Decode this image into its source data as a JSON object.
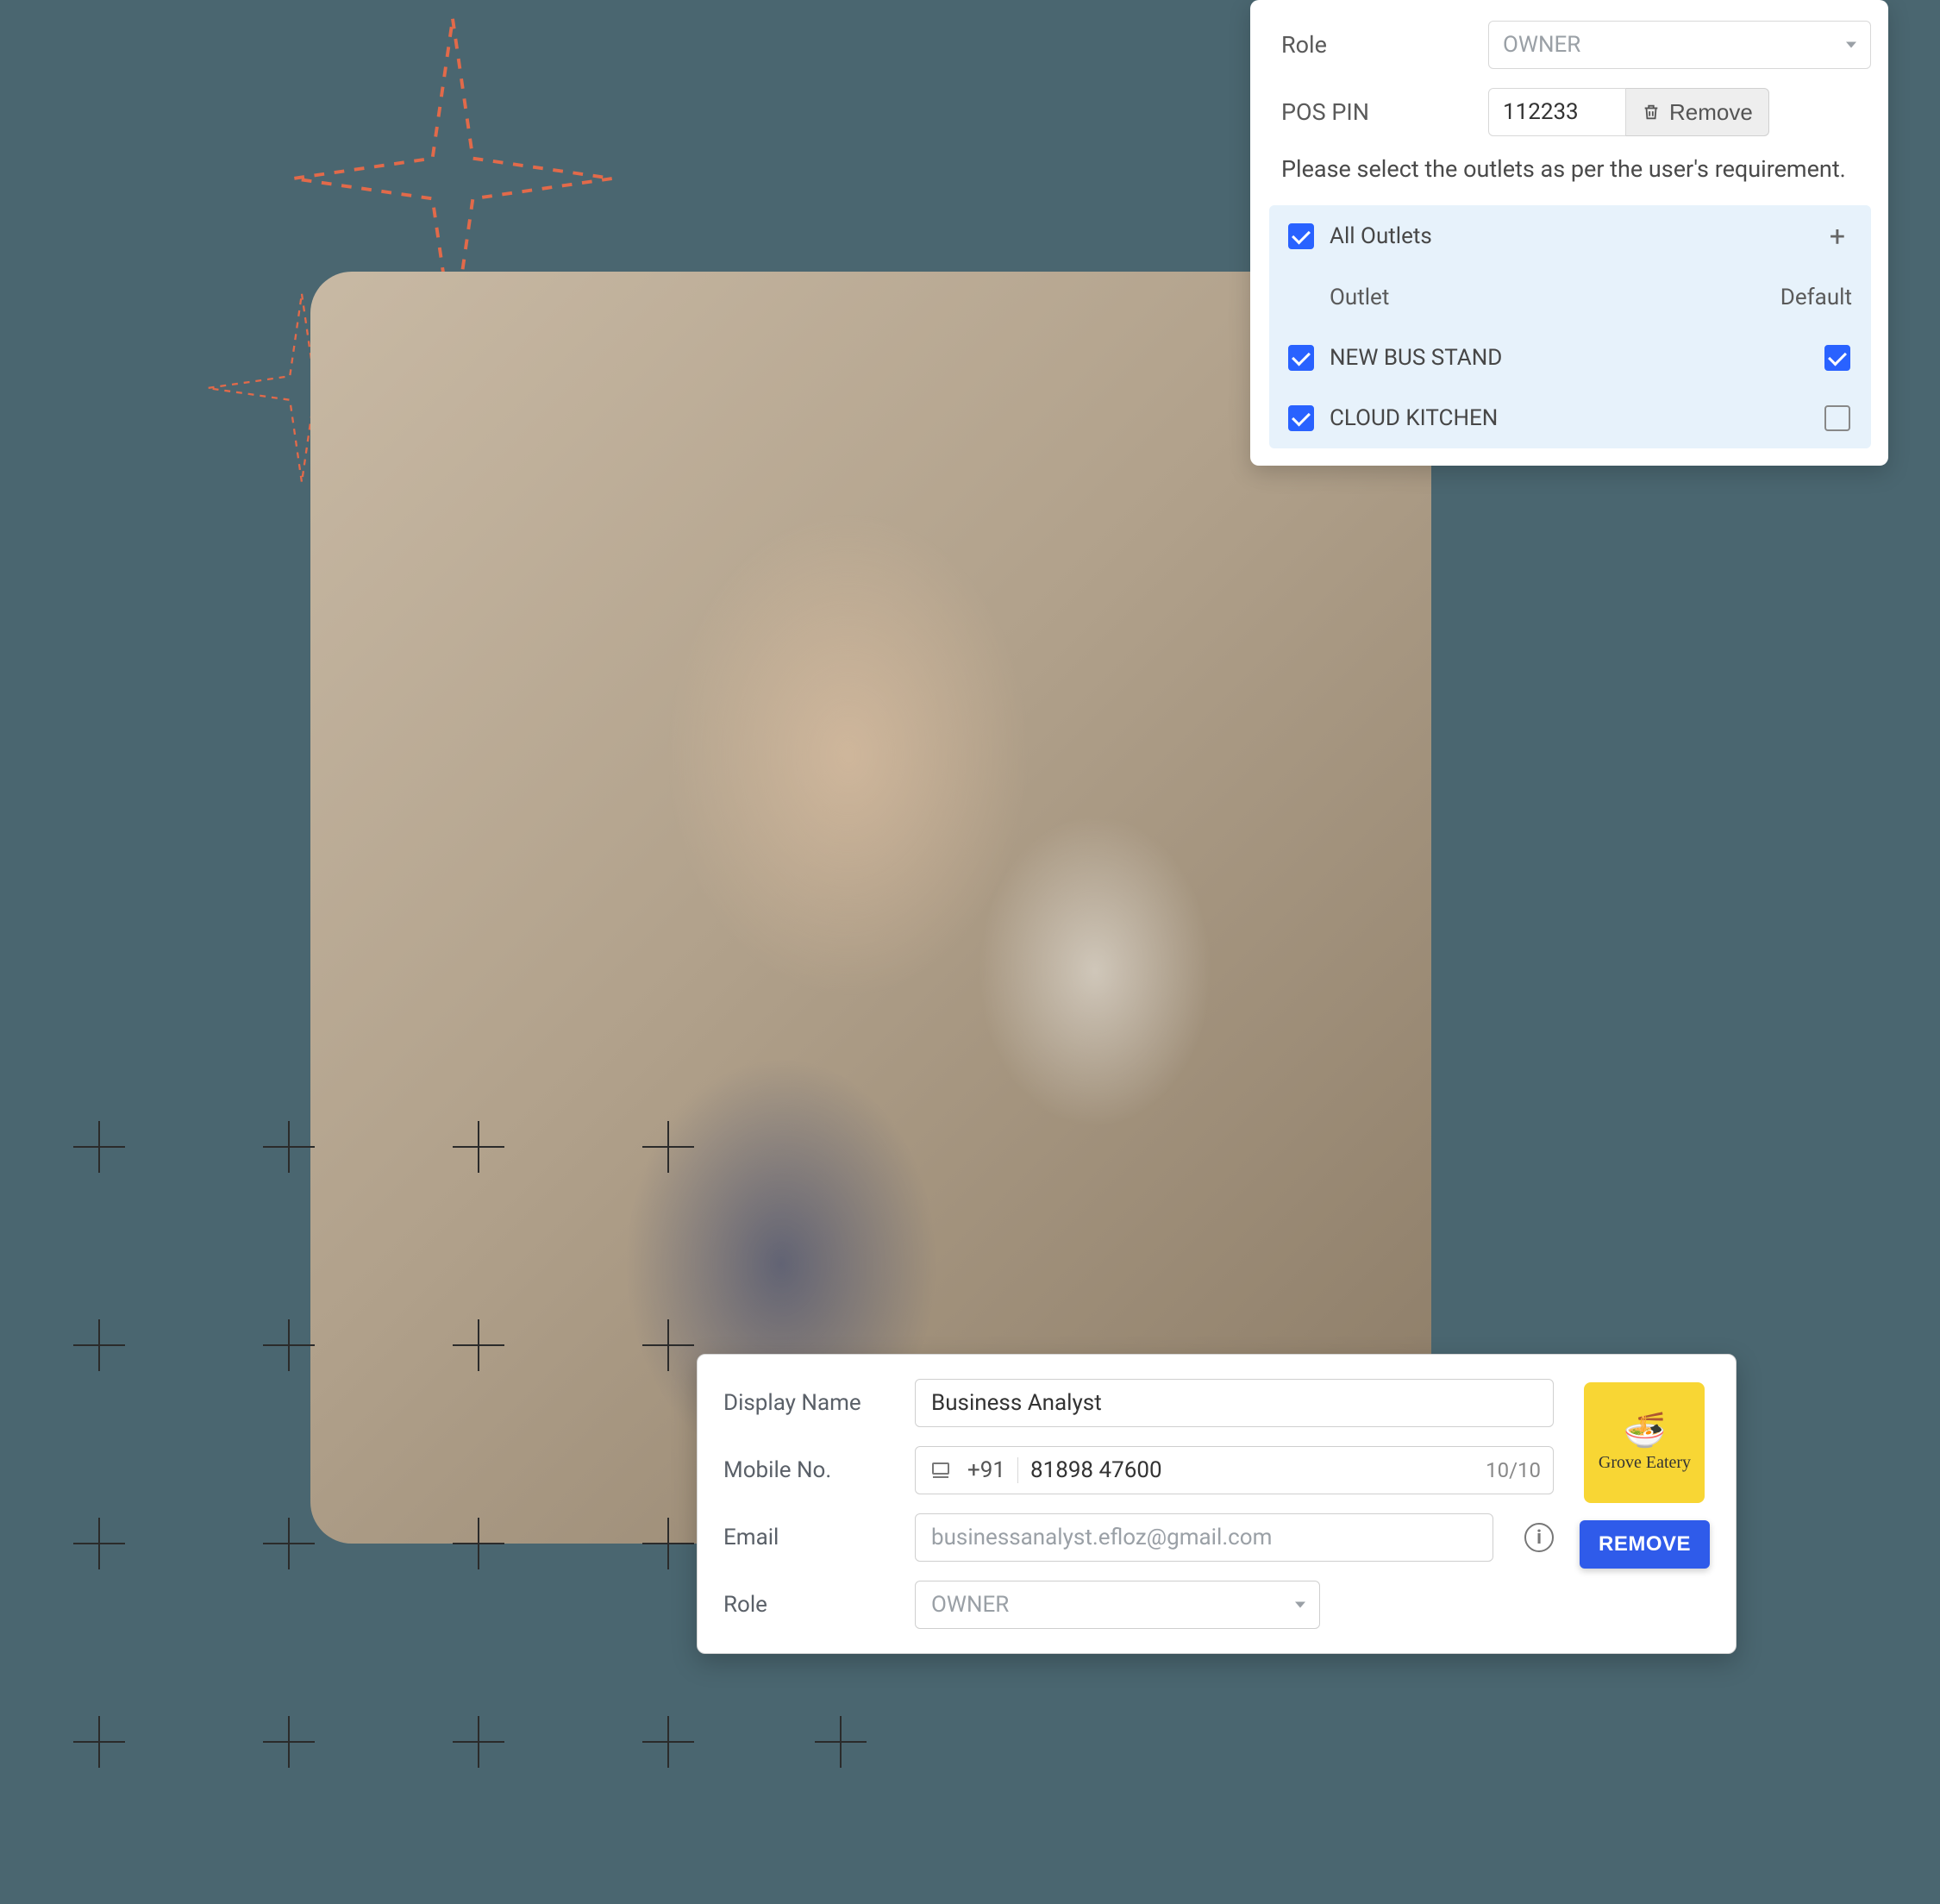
{
  "top_card": {
    "role_label": "Role",
    "role_value": "OWNER",
    "pin_label": "POS PIN",
    "pin_value": "112233",
    "remove_label": "Remove",
    "instruction": "Please select the outlets as per the user's requirement.",
    "all_outlets_label": "All Outlets",
    "outlet_header": "Outlet",
    "default_header": "Default",
    "outlets": [
      {
        "name": "NEW BUS STAND",
        "checked": true,
        "default": true
      },
      {
        "name": "CLOUD KITCHEN",
        "checked": true,
        "default": false
      }
    ]
  },
  "bottom_card": {
    "display_name_label": "Display Name",
    "display_name_value": "Business Analyst",
    "mobile_label": "Mobile No.",
    "mobile_cc": "+91",
    "mobile_value": "81898 47600",
    "mobile_count": "10/10",
    "email_label": "Email",
    "email_placeholder": "businessanalyst.efloz@gmail.com",
    "role_label": "Role",
    "role_value": "OWNER",
    "brand_name": "Grove Eatery",
    "remove_btn": "REMOVE"
  }
}
